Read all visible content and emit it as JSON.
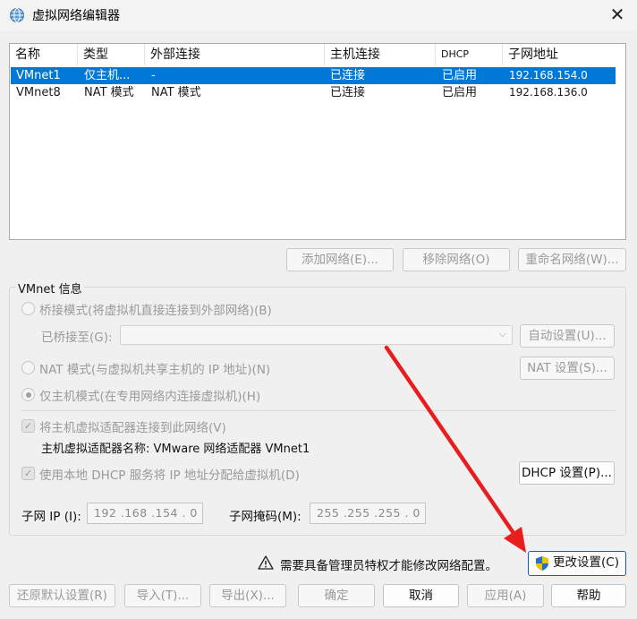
{
  "window": {
    "title": "虚拟网络编辑器",
    "close": "✕"
  },
  "table": {
    "headers": [
      "名称",
      "类型",
      "外部连接",
      "主机连接",
      "DHCP",
      "子网地址"
    ],
    "rows": [
      [
        "VMnet1",
        "仅主机...",
        "-",
        "已连接",
        "已启用",
        "192.168.154.0"
      ],
      [
        "VMnet8",
        "NAT 模式",
        "NAT 模式",
        "已连接",
        "已启用",
        "192.168.136.0"
      ]
    ],
    "selected_row": 0
  },
  "list_buttons": {
    "add": "添加网络(E)...",
    "remove": "移除网络(O)",
    "rename": "重命名网络(W)..."
  },
  "vmnet_info": {
    "label": "VMnet 信息",
    "bridged": "桥接模式(将虚拟机直接连接到外部网络)(B)",
    "bridged_to": "已桥接至(G):",
    "bridged_to_value": "",
    "auto_settings": "自动设置(U)...",
    "nat": "NAT 模式(与虚拟机共享主机的 IP 地址)(N)",
    "nat_settings": "NAT 设置(S)...",
    "host_only": "仅主机模式(在专用网络内连接虚拟机)(H)",
    "connect_adapter": "将主机虚拟适配器连接到此网络(V)",
    "adapter_name": "主机虚拟适配器名称: VMware 网络适配器 VMnet1",
    "use_dhcp": "使用本地 DHCP 服务将 IP 地址分配给虚拟机(D)",
    "dhcp_settings": "DHCP 设置(P)...",
    "subnet_ip_label": "子网 IP (I):",
    "subnet_ip": "192 .168 .154 .  0",
    "subnet_mask_label": "子网掩码(M):",
    "subnet_mask": "255 .255 .255 .  0"
  },
  "admin": {
    "notice": "需要具备管理员特权才能修改网络配置。",
    "change_settings": "更改设置(C)"
  },
  "footer": {
    "restore": "还原默认设置(R)",
    "import": "导入(T)...",
    "export": "导出(X)...",
    "ok": "确定",
    "cancel": "取消",
    "apply": "应用(A)",
    "help": "帮助"
  },
  "colors": {
    "selection": "#0078d7",
    "arrow": "#e81e1e",
    "accent_border": "#0067c0"
  },
  "icons": {
    "title": "network-globe-icon",
    "warning": "warning-icon",
    "shield": "uac-shield-icon"
  }
}
